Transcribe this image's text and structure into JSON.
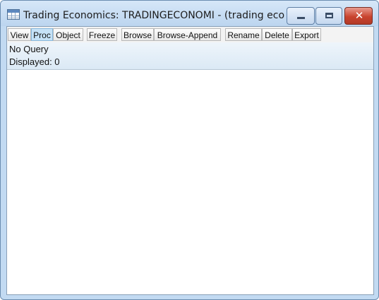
{
  "window": {
    "title": "Trading Economics: TRADINGECONOMI - (trading econo...",
    "controls": {
      "minimize_icon": "minimize-icon",
      "maximize_icon": "maximize-icon",
      "close_icon": "close-icon",
      "close_glyph": "✕"
    }
  },
  "toolbar": {
    "buttons": [
      {
        "label": "View"
      },
      {
        "label": "Proc",
        "active": true
      },
      {
        "label": "Object"
      },
      {
        "label": "Freeze"
      },
      {
        "label": "Browse"
      },
      {
        "label": "Browse-Append"
      },
      {
        "label": "Rename"
      },
      {
        "label": "Delete"
      },
      {
        "label": "Export"
      }
    ]
  },
  "info": {
    "query": "No Query",
    "displayed": "Displayed: 0"
  },
  "colors": {
    "frame": "#c2daf2",
    "close_button": "#c9442f",
    "active_button": "#c6e2f7"
  }
}
